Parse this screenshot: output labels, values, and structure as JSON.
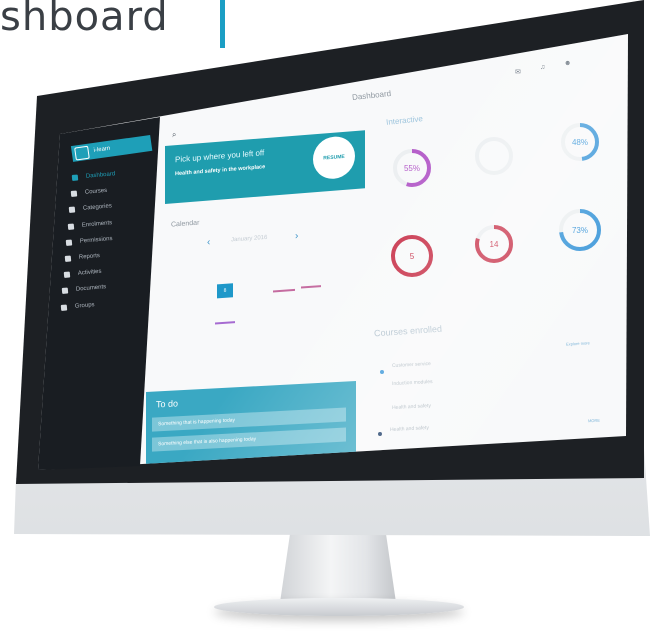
{
  "headline": "shboard",
  "colors": {
    "accent": "#1f9dae",
    "sidebar": "#191d22",
    "ring_purple": "#b35ac8",
    "ring_red": "#c8324a",
    "ring_blue": "#3b97d9"
  },
  "sidebar": {
    "brand": "i-learn",
    "items": [
      {
        "label": "Dashboard",
        "icon": "home-icon"
      },
      {
        "label": "Courses",
        "icon": "book-icon"
      },
      {
        "label": "Categories",
        "icon": "grid-icon"
      },
      {
        "label": "Enrolments",
        "icon": "check-icon"
      },
      {
        "label": "Permissions",
        "icon": "lock-icon"
      },
      {
        "label": "Reports",
        "icon": "chart-icon"
      },
      {
        "label": "Activities",
        "icon": "activity-icon"
      },
      {
        "label": "Documents",
        "icon": "document-icon"
      },
      {
        "label": "Groups",
        "icon": "people-icon"
      }
    ]
  },
  "topbar": {
    "title": "Dashboard",
    "search_icon": "search-icon",
    "chat_icon": "chat-icon",
    "bell_icon": "bell-icon",
    "user_icon": "user-icon"
  },
  "pickup": {
    "title": "Pick up where you left off",
    "course": "Health and safety in the workplace",
    "button": "RESUME"
  },
  "calendar": {
    "title": "Calendar",
    "month": "January 2016",
    "selected_day": "8"
  },
  "todo": {
    "title": "To do",
    "items": [
      "Something that is happening today",
      "Something else that is also happening today"
    ]
  },
  "interactive": {
    "title": "Interactive"
  },
  "rings": [
    {
      "value": "55%",
      "color": "#b35ac8",
      "progress": 0.55
    },
    {
      "value": "",
      "color": "#e4e7ea",
      "progress": 0.0
    },
    {
      "value": "48%",
      "color": "#3b97d9",
      "progress": 0.48
    },
    {
      "value": "5",
      "color": "#c8324a",
      "progress": 1.0
    },
    {
      "value": "14",
      "color": "#c8324a",
      "progress": 0.8
    },
    {
      "value": "73%",
      "color": "#3b97d9",
      "progress": 0.73
    }
  ],
  "courses": {
    "title": "Courses enrolled",
    "link_top": "Explore more",
    "link_bottom": "MORE",
    "items": [
      "Customer service",
      "Induction modules",
      "Health and safety",
      "Health and safety"
    ]
  }
}
